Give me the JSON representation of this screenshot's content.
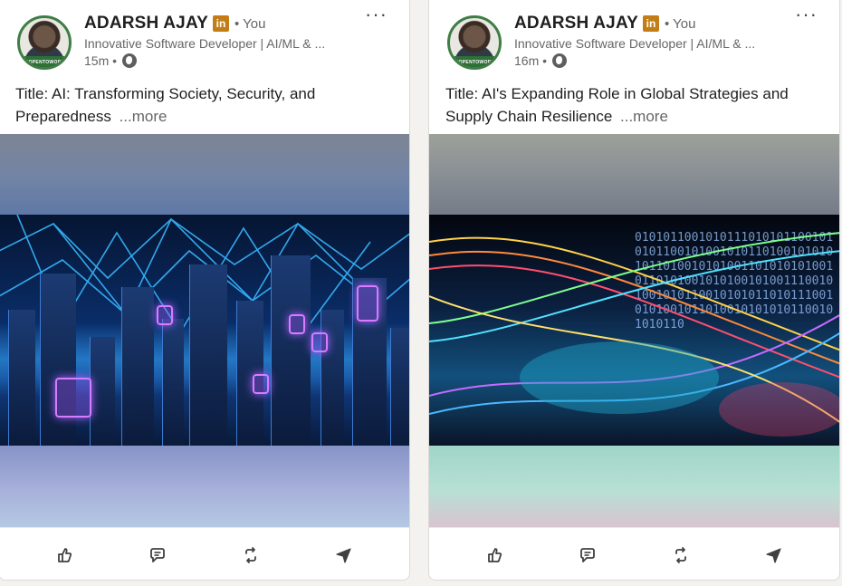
{
  "feed": {
    "posts": [
      {
        "author": {
          "name": "ADARSH AJAY",
          "badge": "in",
          "you_label": "• You",
          "headline": "Innovative Software Developer | AI/ML & ...",
          "avatar_caption": "#OPENTOWORK"
        },
        "time": "15m •",
        "text": "Title: AI: Transforming Society, Security, and Preparedness",
        "see_more": "...more",
        "image": {
          "icon": "neon-city-network-image"
        }
      },
      {
        "author": {
          "name": "ADARSH AJAY",
          "badge": "in",
          "you_label": "• You",
          "headline": "Innovative Software Developer | AI/ML & ...",
          "avatar_caption": "#OPENTOWORK"
        },
        "time": "16m •",
        "text": "Title: AI's Expanding Role in Global Strategies and Supply Chain Resilience",
        "see_more": "...more",
        "image": {
          "icon": "global-data-streams-image"
        }
      }
    ],
    "actions": [
      "like-icon",
      "comment-icon",
      "repost-icon",
      "send-icon"
    ],
    "colors": {
      "badge": "#c37d16",
      "avatar_ring": "#3e7e44",
      "text_muted": "#666666"
    }
  }
}
